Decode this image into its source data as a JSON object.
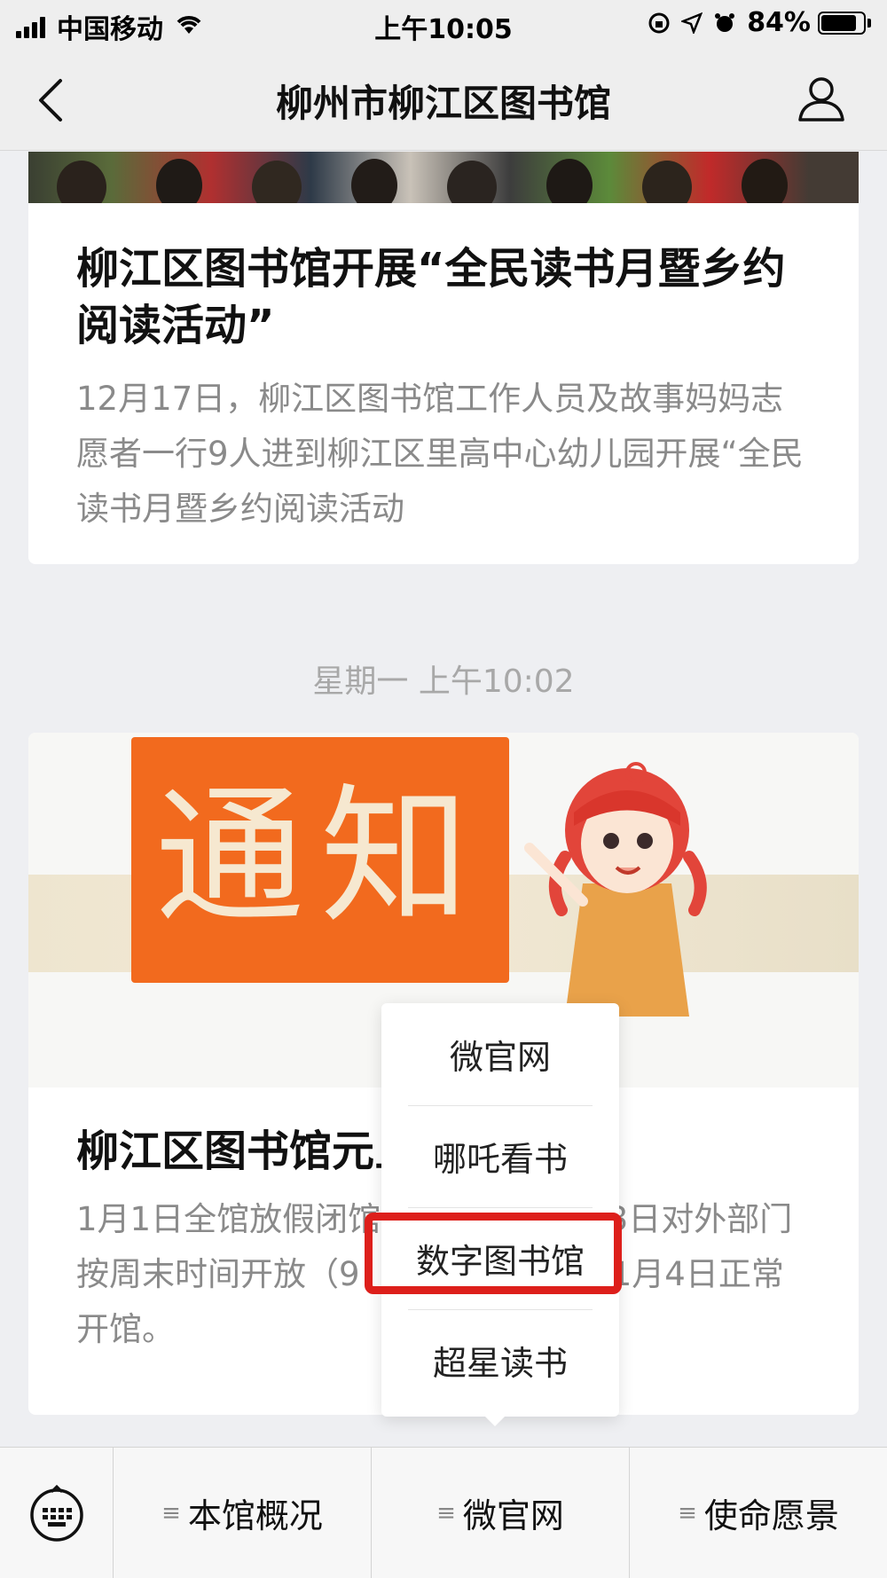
{
  "status_bar": {
    "carrier": "中国移动",
    "time": "上午10:05",
    "battery": "84%",
    "battery_level": 0.84
  },
  "nav": {
    "title": "柳州市柳江区图书馆",
    "back_icon": "chevron-left-icon",
    "profile_icon": "person-icon"
  },
  "feed": {
    "article1": {
      "title": "柳江区图书馆开展“全民读书月暨乡约阅读活动”",
      "desc": "12月17日，柳江区图书馆工作人员及故事妈妈志愿者一行9人进到柳江区里高中心幼儿园开展“全民读书月暨乡约阅读活动"
    },
    "timestamp": "星期一 上午10:02",
    "article2": {
      "image_text": "通知",
      "title": "柳江区图书馆元旦放假通知",
      "desc": "1月1日全馆放假闭馆，1月2日至1月3日对外部门按周末时间开放（9：00—16:00）；1月4日正常开馆。"
    }
  },
  "popup_menu": {
    "items": [
      "微官网",
      "哪吒看书",
      "数字图书馆",
      "超星读书"
    ],
    "highlight_color": "#dd1f1b"
  },
  "bottom_menu": {
    "keyboard_icon": "keyboard-icon",
    "items": [
      "本馆概况",
      "微官网",
      "使命愿景"
    ],
    "menu_icon": "≡"
  }
}
